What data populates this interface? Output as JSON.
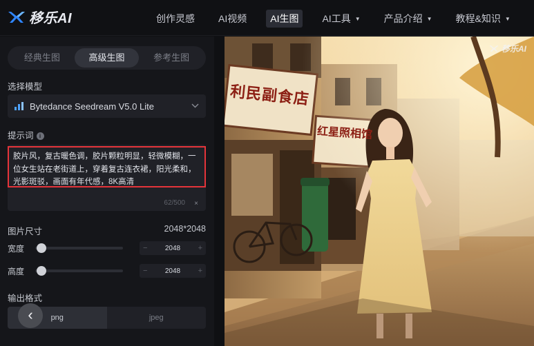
{
  "brand": {
    "name": "移乐AI"
  },
  "nav": {
    "items": [
      {
        "label": "创作灵感",
        "dropdown": false,
        "active": false
      },
      {
        "label": "AI视频",
        "dropdown": false,
        "active": false
      },
      {
        "label": "AI生图",
        "dropdown": false,
        "active": true
      },
      {
        "label": "AI工具",
        "dropdown": true,
        "active": false
      },
      {
        "label": "产品介绍",
        "dropdown": true,
        "active": false
      },
      {
        "label": "教程&知识",
        "dropdown": true,
        "active": false
      }
    ],
    "caret": "▼"
  },
  "panel": {
    "tabs": [
      "经典生图",
      "高级生图",
      "参考生图"
    ],
    "active_tab": 1,
    "model_label": "选择模型",
    "model_value": "Bytedance Seedream V5.0 Lite",
    "prompt_label": "提示词",
    "prompt_text": "胶片风，复古暖色调，胶片颗粒明显，轻微模糊，一位女生站在老街道上，穿着复古连衣裙，阳光柔和，光影斑驳，画面有年代感，8K高清",
    "prompt_counter": "62/500",
    "clear_symbol": "×",
    "size_label": "图片尺寸",
    "size_value": "2048*2048",
    "width_label": "宽度",
    "width_value": "2048",
    "height_label": "高度",
    "height_value": "2048",
    "minus": "−",
    "plus": "+",
    "format_label": "输出格式",
    "formats": [
      "png",
      "jpeg"
    ],
    "back_symbol": "‹"
  },
  "image": {
    "sign_1": "利民副食店",
    "sign_2": "红星照相馆",
    "watermark": "移乐AI"
  },
  "colors": {
    "accent_blue": "#4ea3ff",
    "highlight_red": "#e5343a"
  }
}
